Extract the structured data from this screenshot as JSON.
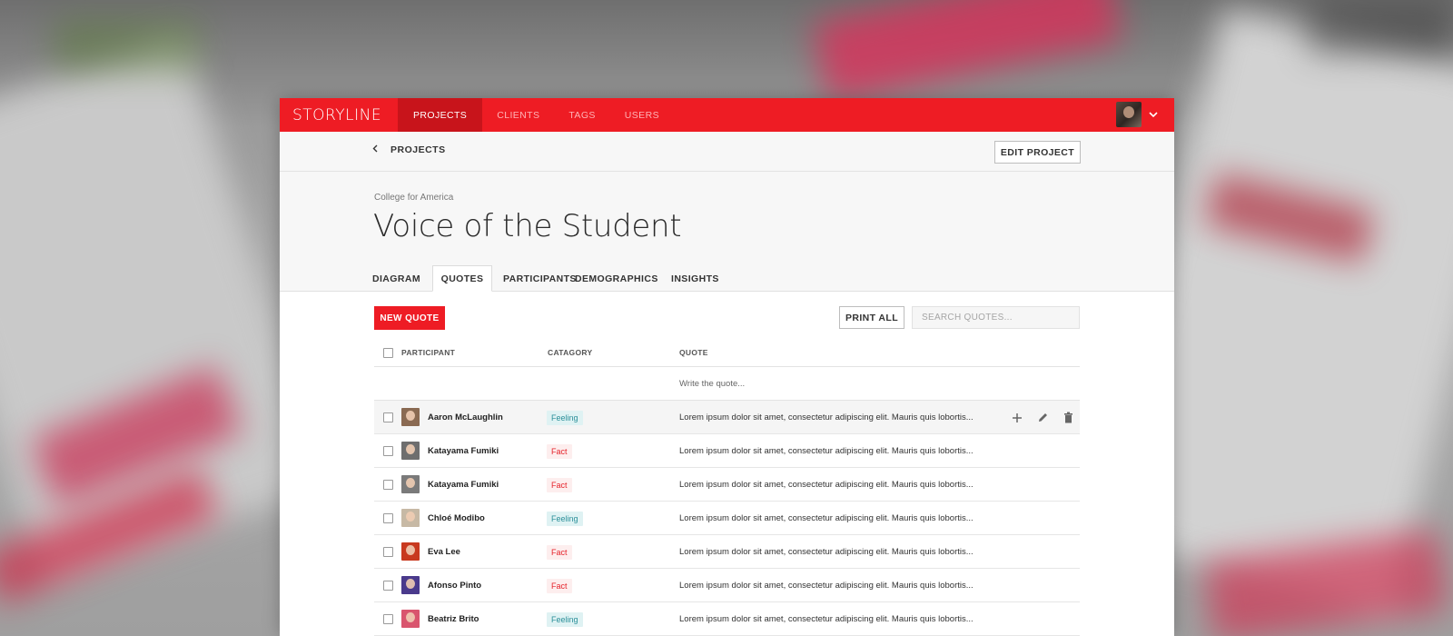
{
  "app": {
    "logo": "STORYLINE",
    "nav": [
      "PROJECTS",
      "CLIENTS",
      "TAGS",
      "USERS"
    ],
    "active_nav": "PROJECTS"
  },
  "subbar": {
    "back_label": "PROJECTS",
    "edit_label": "EDIT PROJECT"
  },
  "project": {
    "org": "College for America",
    "title": "Voice of the Student"
  },
  "tabs": [
    "DIAGRAM",
    "QUOTES",
    "PARTICIPANTS",
    "DEMOGRAPHICS",
    "INSIGHTS"
  ],
  "active_tab": "QUOTES",
  "toolbar": {
    "new_label": "NEW QUOTE",
    "print_label": "PRINT ALL",
    "search_placeholder": "SEARCH QUOTES..."
  },
  "table": {
    "columns": [
      "PARTICIPANT",
      "CATAGORY",
      "QUOTE"
    ],
    "write_placeholder": "Write the quote...",
    "rows": [
      {
        "name": "Aaron McLaughlin",
        "category": "Feeling",
        "quote": "Lorem ipsum dolor sit amet, consectetur adipiscing elit. Mauris quis lobortis...",
        "avatar_color": "#8a6a52"
      },
      {
        "name": "Katayama Fumiki",
        "category": "Fact",
        "quote": "Lorem ipsum dolor sit amet, consectetur adipiscing elit. Mauris quis lobortis...",
        "avatar_color": "#6e6e6e"
      },
      {
        "name": "Katayama Fumiki",
        "category": "Fact",
        "quote": "Lorem ipsum dolor sit amet, consectetur adipiscing elit. Mauris quis lobortis...",
        "avatar_color": "#7a7a7a"
      },
      {
        "name": "Chloé Modibo",
        "category": "Feeling",
        "quote": "Lorem ipsum dolor sit amet, consectetur adipiscing elit. Mauris quis lobortis...",
        "avatar_color": "#c7b9a5"
      },
      {
        "name": "Eva Lee",
        "category": "Fact",
        "quote": "Lorem ipsum dolor sit amet, consectetur adipiscing elit. Mauris quis lobortis...",
        "avatar_color": "#c8391f"
      },
      {
        "name": "Afonso Pinto",
        "category": "Fact",
        "quote": "Lorem ipsum dolor sit amet, consectetur adipiscing elit. Mauris quis lobortis...",
        "avatar_color": "#4a3a8c"
      },
      {
        "name": "Beatriz Brito",
        "category": "Feeling",
        "quote": "Lorem ipsum dolor sit amet, consectetur adipiscing elit. Mauris quis lobortis...",
        "avatar_color": "#d9556e"
      }
    ]
  },
  "row_actions": [
    "plus-icon",
    "pencil-icon",
    "trash-icon"
  ],
  "colors": {
    "brand": "#ee1c24",
    "feeling_bg": "#dff2f3",
    "feeling_text": "#2b8f99",
    "fact_bg": "#fdeeee",
    "fact_text": "#e5222a"
  }
}
